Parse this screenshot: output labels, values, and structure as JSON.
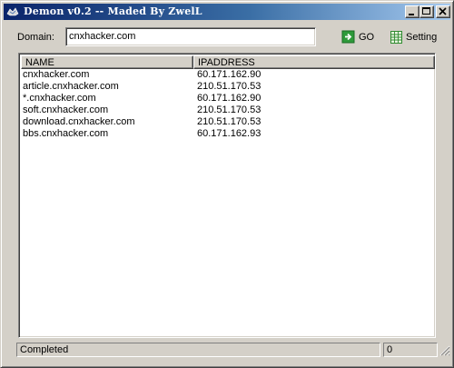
{
  "window": {
    "title": "Demon v0.2 -- Maded By ZwelL",
    "buttons": {
      "minimize_icon": "minimize-icon",
      "maximize_icon": "maximize-icon",
      "close_icon": "close-icon"
    }
  },
  "toolbar": {
    "domain_label": "Domain:",
    "domain_value": "cnxhacker.com",
    "go_label": "GO",
    "go_icon": "green-arrow-right-icon",
    "setting_label": "Setting",
    "setting_icon": "spreadsheet-grid-icon"
  },
  "list": {
    "columns": [
      "NAME",
      "IPADDRESS"
    ],
    "rows": [
      {
        "name": "cnxhacker.com",
        "ip": "60.171.162.90"
      },
      {
        "name": "article.cnxhacker.com",
        "ip": "210.51.170.53"
      },
      {
        "name": "*.cnxhacker.com",
        "ip": "60.171.162.90"
      },
      {
        "name": "soft.cnxhacker.com",
        "ip": "210.51.170.53"
      },
      {
        "name": "download.cnxhacker.com",
        "ip": "210.51.170.53"
      },
      {
        "name": "bbs.cnxhacker.com",
        "ip": "60.171.162.93"
      }
    ]
  },
  "status": {
    "text": "Completed",
    "count": "0"
  },
  "colors": {
    "titlebar_start": "#0a246a",
    "titlebar_end": "#a6caf0",
    "face": "#d4d0c8"
  }
}
